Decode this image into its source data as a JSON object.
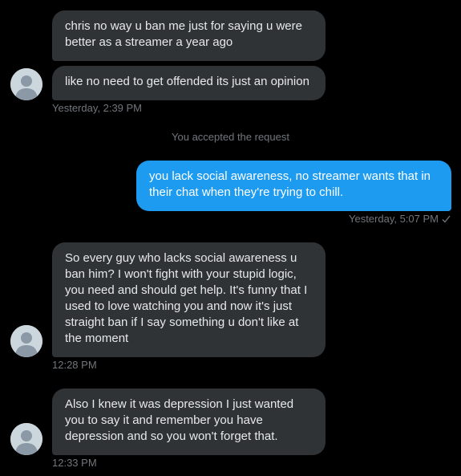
{
  "messages": [
    {
      "text": "chris no way u ban me just for saying u were better as a streamer a year ago"
    },
    {
      "text": "like no need to get offended its just an opinion"
    },
    {
      "text": "you lack social awareness, no streamer wants that in their chat when they're trying to chill."
    },
    {
      "text": "So every guy who lacks social awareness u ban him? I won't fight with your stupid logic, you need and should get help. It's funny that I used to love watching you and now it's just straight ban if I say something u don't like at the moment"
    },
    {
      "text": "Also I knew it was depression I just wanted you to say it and remember you have depression and so you won't forget that."
    }
  ],
  "timestamps": {
    "group1": "Yesterday, 2:39 PM",
    "sent": "Yesterday, 5:07 PM",
    "group2": "12:28 PM",
    "group3": "12:33 PM"
  },
  "system_message": "You accepted the request",
  "sent_status_icon": "checkmark-icon",
  "colors": {
    "background": "#000000",
    "incoming_bubble": "#2f3336",
    "outgoing_bubble": "#1d9bf0",
    "meta_text": "#71767b",
    "avatar": "#ccd6dd"
  }
}
